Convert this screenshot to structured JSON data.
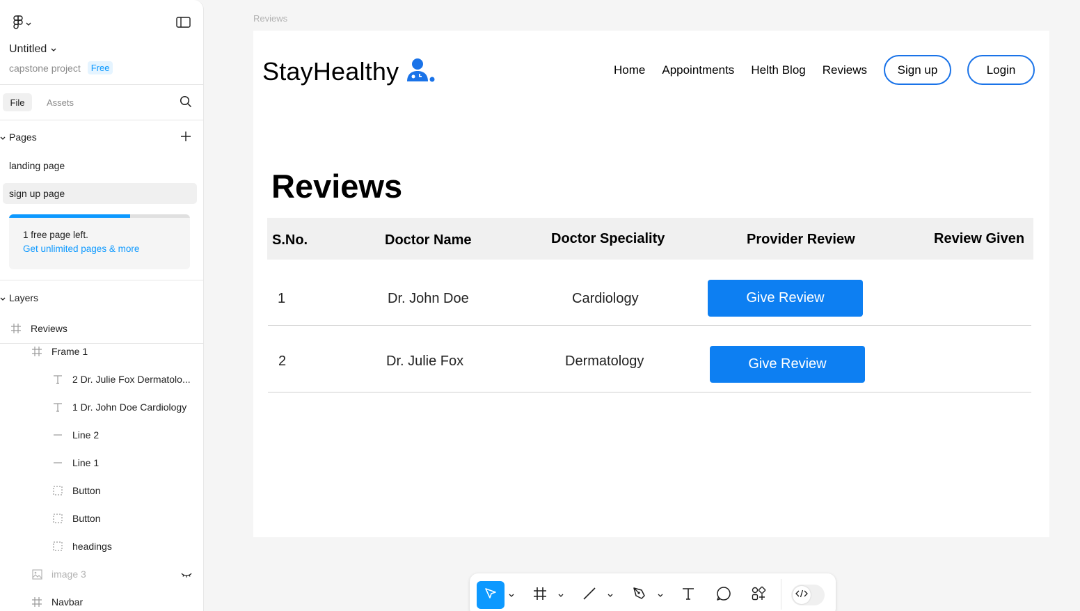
{
  "left_panel": {
    "file_name": "Untitled",
    "project_name": "capstone project",
    "plan_badge": "Free",
    "tabs": {
      "file": "File",
      "assets": "Assets"
    },
    "pages_header": "Pages",
    "pages": [
      {
        "label": "landing page"
      },
      {
        "label": "sign up page"
      }
    ],
    "upgrade": {
      "text": "1 free page left.",
      "link": "Get unlimited pages & more",
      "progress_fraction": 0.67
    },
    "layers_header": "Layers",
    "layers": [
      {
        "label": "Reviews",
        "icon": "frame-icon"
      },
      {
        "label": "Frame 1",
        "icon": "frame-icon"
      },
      {
        "label": "2 Dr. Julie Fox Dermatolo...",
        "icon": "text-icon"
      },
      {
        "label": "1 Dr. John Doe Cardiology",
        "icon": "text-icon"
      },
      {
        "label": "Line 2",
        "icon": "line-icon"
      },
      {
        "label": "Line 1",
        "icon": "line-icon"
      },
      {
        "label": "Button",
        "icon": "component-dashed-icon"
      },
      {
        "label": "Button",
        "icon": "component-dashed-icon"
      },
      {
        "label": "headings",
        "icon": "component-dashed-icon"
      },
      {
        "label": "image 3",
        "icon": "image-icon"
      },
      {
        "label": "Navbar",
        "icon": "frame-icon"
      }
    ]
  },
  "canvas": {
    "frame_label": "Reviews",
    "site": {
      "brand": "StayHealthy",
      "nav": {
        "home": "Home",
        "appointments": "Appointments",
        "blog": "Helth Blog",
        "reviews": "Reviews",
        "signup": "Sign up",
        "login": "Login"
      },
      "heading": "Reviews",
      "table": {
        "headers": {
          "sno": "S.No.",
          "name": "Doctor Name",
          "speciality": "Doctor Speciality",
          "provider_review": "Provider Review",
          "review_given": "Review Given"
        },
        "rows": [
          {
            "sno": "1",
            "name": "Dr. John Doe",
            "speciality": "Cardiology",
            "button": "Give Review"
          },
          {
            "sno": "2",
            "name": "Dr. Julie Fox",
            "speciality": "Dermatology",
            "button": "Give Review"
          }
        ]
      }
    }
  },
  "colors": {
    "accent": "#0d99ff",
    "primary_button": "#0d7ff2",
    "nav_button_border": "#1a73e8"
  },
  "toolbar": {
    "tools": [
      "move-icon",
      "frame-tool-icon",
      "line-tool-icon",
      "pen-tool-icon",
      "text-tool-icon",
      "comment-icon",
      "actions-icon"
    ],
    "dev_mode": "code-icon"
  }
}
